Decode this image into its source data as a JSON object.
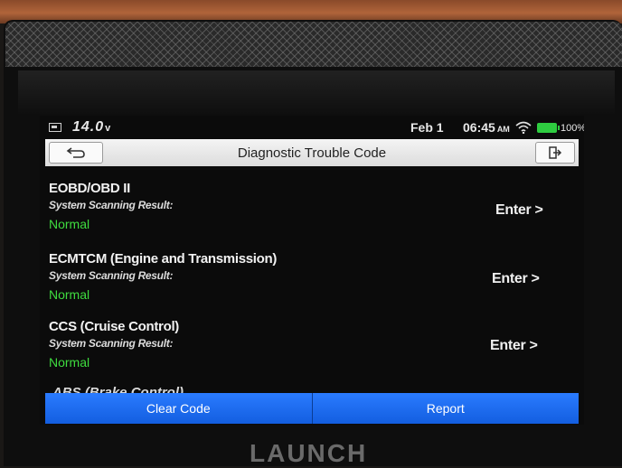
{
  "status": {
    "voltage": "14.0",
    "voltage_unit": "v",
    "date": "Feb 1",
    "time": "06:45",
    "ampm": "AM",
    "battery_pct": "100%"
  },
  "header": {
    "title": "Diagnostic Trouble Code"
  },
  "systems": [
    {
      "name": "EOBD/OBD II",
      "result_label": "System Scanning Result:",
      "status": "Normal",
      "action": "Enter >"
    },
    {
      "name": "ECMTCM (Engine and Transmission)",
      "result_label": "System Scanning Result:",
      "status": "Normal",
      "action": "Enter >"
    },
    {
      "name": "CCS (Cruise Control)",
      "result_label": "System Scanning Result:",
      "status": "Normal",
      "action": "Enter >"
    }
  ],
  "partial_item": "ABS (Brake Control)",
  "buttons": {
    "clear_code": "Clear Code",
    "report": "Report"
  },
  "brand": "LAUNCH",
  "colors": {
    "status_normal": "#3fdc3f",
    "button_blue": "#1e6ef0",
    "battery_green": "#2ecc40"
  }
}
